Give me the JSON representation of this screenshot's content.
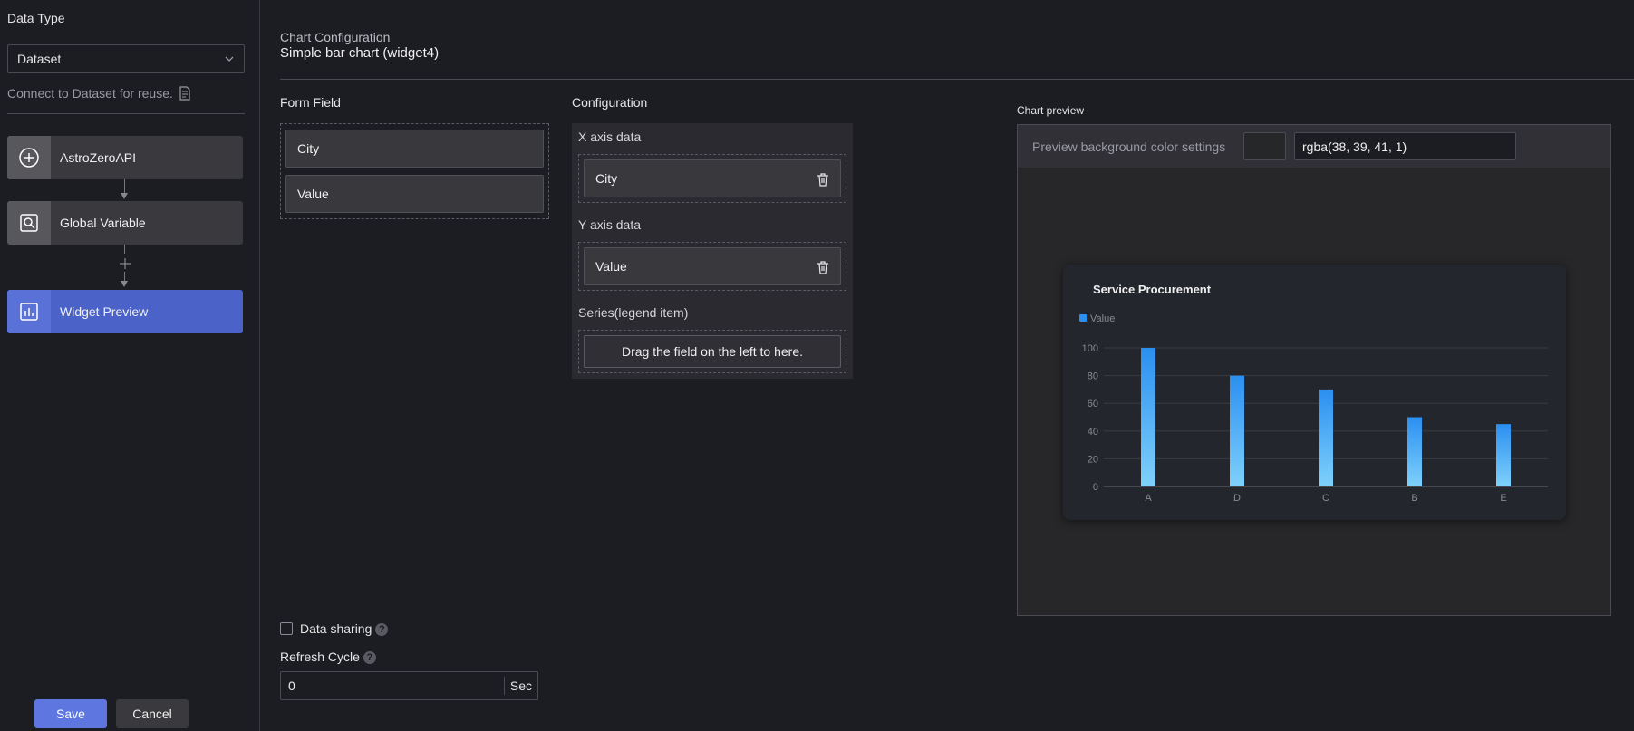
{
  "sidebar": {
    "title": "Data Type",
    "select_value": "Dataset",
    "hint": "Connect to Dataset for reuse.",
    "nodes": [
      {
        "label": "AstroZeroAPI",
        "icon": "plus-circle-icon"
      },
      {
        "label": "Global Variable",
        "icon": "variable-icon"
      },
      {
        "label": "Widget Preview",
        "icon": "chart-icon"
      }
    ],
    "save_label": "Save",
    "cancel_label": "Cancel"
  },
  "main": {
    "section_title": "Chart Configuration",
    "widget_name": "Simple bar chart (widget4)",
    "form_field": {
      "title": "Form Field",
      "fields": [
        "City",
        "Value"
      ]
    },
    "configuration": {
      "title": "Configuration",
      "x_axis_label": "X axis data",
      "x_axis_field": "City",
      "y_axis_label": "Y axis data",
      "y_axis_field": "Value",
      "series_label": "Series(legend item)",
      "series_drop": "Drag the field on the left to here."
    },
    "data_sharing_label": "Data sharing",
    "refresh_cycle_label": "Refresh Cycle",
    "refresh_cycle_value": "0",
    "refresh_cycle_unit": "Sec"
  },
  "preview": {
    "title": "Chart preview",
    "bg_label": "Preview background color settings",
    "bg_value": "rgba(38, 39, 41, 1)"
  },
  "colors": {
    "accent": "#5d76e0",
    "bar_top": "#2b8ff0",
    "bar_bottom": "#7fd1fb"
  },
  "chart_data": {
    "type": "bar",
    "title": "Service Procurement",
    "categories": [
      "A",
      "D",
      "C",
      "B",
      "E"
    ],
    "series": [
      {
        "name": "Value",
        "values": [
          100,
          80,
          70,
          50,
          45
        ]
      }
    ],
    "ylim": [
      0,
      100
    ],
    "yticks": [
      0,
      20,
      40,
      60,
      80,
      100
    ],
    "legend": "top-left",
    "grid": true
  }
}
